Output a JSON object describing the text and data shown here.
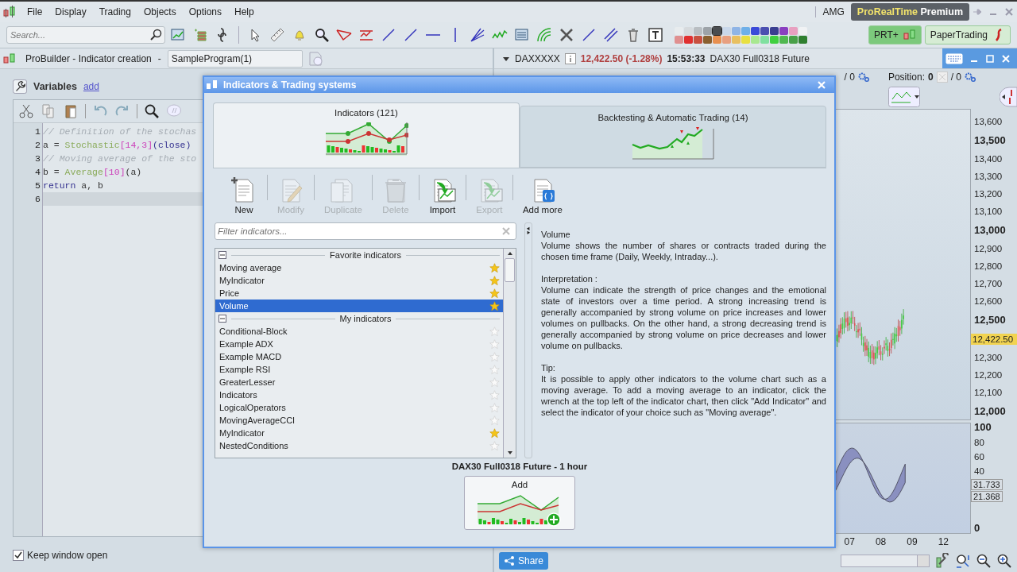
{
  "menu_bar": {
    "items": [
      "File",
      "Display",
      "Trading",
      "Objects",
      "Options",
      "Help"
    ],
    "user": "AMG",
    "edition": {
      "brand": "ProRealTime",
      "tier": "Premium"
    }
  },
  "toolbar": {
    "search_placeholder": "Search...",
    "swatches": [
      {
        "color": "#e8ecee",
        "selected": false
      },
      {
        "color": "#d6dadd",
        "selected": false
      },
      {
        "color": "#b9bec2",
        "selected": false
      },
      {
        "color": "#9da3a8",
        "selected": false
      },
      {
        "color": "#4a4d50",
        "selected": true
      },
      {
        "color": "#c9d8ea",
        "selected": false
      },
      {
        "color": "#8fb5e6",
        "selected": false
      },
      {
        "color": "#6fb0e8",
        "selected": false
      },
      {
        "color": "#3a4ad8",
        "selected": false
      },
      {
        "color": "#4a4fb0",
        "selected": false
      },
      {
        "color": "#3a3f90",
        "selected": false
      },
      {
        "color": "#8a3fc0",
        "selected": false
      },
      {
        "color": "#e8a0c0",
        "selected": false
      },
      {
        "color": "#f0f2f4",
        "selected": false
      },
      {
        "color": "#e09090",
        "selected": false
      },
      {
        "color": "#e03030",
        "selected": false
      },
      {
        "color": "#c85040",
        "selected": false
      },
      {
        "color": "#8a6030",
        "selected": false
      },
      {
        "color": "#e89050",
        "selected": false
      },
      {
        "color": "#e8a080",
        "selected": false
      },
      {
        "color": "#e8c060",
        "selected": false
      },
      {
        "color": "#e8e040",
        "selected": false
      },
      {
        "color": "#a8e890",
        "selected": false
      },
      {
        "color": "#80e0a0",
        "selected": false
      },
      {
        "color": "#40d040",
        "selected": false
      },
      {
        "color": "#50b850",
        "selected": false
      },
      {
        "color": "#48a048",
        "selected": false
      },
      {
        "color": "#308030",
        "selected": false
      }
    ],
    "buttons": [
      {
        "label": "PRT+",
        "kind": "prt"
      },
      {
        "label": "PaperTrading",
        "kind": "paper"
      }
    ]
  },
  "editor_window": {
    "title": "ProBuilder - Indicator creation",
    "separator": "-",
    "program": "SampleProgram(1)",
    "variables_label": "Variables",
    "add_link": "add",
    "code_lines": [
      {
        "number": "1",
        "current": false,
        "tokens": [
          {
            "kind": "comment",
            "text": "// Definition of the stochas"
          }
        ]
      },
      {
        "number": "2",
        "current": false,
        "tokens": [
          {
            "kind": "plain",
            "text": "a = "
          },
          {
            "kind": "function",
            "text": "Stochastic"
          },
          {
            "kind": "number",
            "text": "[14,3]"
          },
          {
            "kind": "keyword",
            "text": "(close)"
          }
        ]
      },
      {
        "number": "3",
        "current": false,
        "tokens": [
          {
            "kind": "comment",
            "text": "// Moving average of the sto"
          }
        ]
      },
      {
        "number": "4",
        "current": false,
        "tokens": [
          {
            "kind": "plain",
            "text": "b = "
          },
          {
            "kind": "function",
            "text": "Average"
          },
          {
            "kind": "number",
            "text": "[10]"
          },
          {
            "kind": "plain",
            "text": "(a)"
          }
        ]
      },
      {
        "number": "5",
        "current": false,
        "tokens": [
          {
            "kind": "keyword",
            "text": "return"
          },
          {
            "kind": "plain",
            "text": " a, b"
          }
        ]
      },
      {
        "number": "6",
        "current": true
      }
    ],
    "keep_open": {
      "label": "Keep window open",
      "checked": true
    }
  },
  "chart_window": {
    "symbol": "DAXXXXX",
    "price": "12,422.50 (-1.28%)",
    "time": "15:53:33",
    "instrument": "DAX30 Full0318 Future",
    "orders_fragment": "/ 0",
    "position_label": "Position:",
    "position_value": "0",
    "position_orders": "/ 0",
    "price_axis": [
      {
        "label": "13,600",
        "kind": "minor"
      },
      {
        "label": "13,500",
        "kind": "major"
      },
      {
        "label": "13,400",
        "kind": "minor"
      },
      {
        "label": "13,300",
        "kind": "minor"
      },
      {
        "label": "13,200",
        "kind": "minor"
      },
      {
        "label": "13,100",
        "kind": "minor"
      },
      {
        "label": "13,000",
        "kind": "major"
      },
      {
        "label": "12,900",
        "kind": "minor"
      },
      {
        "label": "12,800",
        "kind": "minor"
      },
      {
        "label": "12,700",
        "kind": "minor"
      },
      {
        "label": "12,600",
        "kind": "minor"
      },
      {
        "label": "12,500",
        "kind": "major"
      },
      {
        "label": "12,422.50",
        "kind": "last"
      },
      {
        "label": "12,300",
        "kind": "minor"
      },
      {
        "label": "12,200",
        "kind": "minor"
      },
      {
        "label": "12,100",
        "kind": "minor"
      },
      {
        "label": "12,000",
        "kind": "major"
      }
    ],
    "indicator_axis": [
      {
        "label": "100",
        "major": true
      },
      {
        "label": "80",
        "major": false
      },
      {
        "label": "60",
        "major": false
      },
      {
        "label": "40",
        "major": false
      },
      {
        "label": "0",
        "major": true
      }
    ],
    "indicator_values": [
      "31.733",
      "21.368"
    ],
    "time_axis": [
      "07",
      "08",
      "09",
      "12"
    ],
    "share_label": "Share"
  },
  "dialog": {
    "title": "Indicators & Trading systems",
    "tabs": [
      {
        "label": "Indicators (121)",
        "selected": true,
        "kind": "indicators"
      },
      {
        "label": "Backtesting & Automatic Trading (14)",
        "selected": false,
        "kind": "backtest"
      }
    ],
    "actions": [
      {
        "label": "New",
        "kind": "new",
        "disabled": false
      },
      {
        "label": "Modify",
        "kind": "modify",
        "disabled": true
      },
      {
        "label": "Duplicate",
        "kind": "duplicate",
        "disabled": true
      },
      {
        "label": "Delete",
        "kind": "delete",
        "disabled": true
      },
      {
        "label": "Import",
        "kind": "import",
        "disabled": false
      },
      {
        "label": "Export",
        "kind": "export",
        "disabled": true
      },
      {
        "label": "Add more",
        "kind": "more",
        "disabled": false
      }
    ],
    "filter_placeholder": "Filter indicators...",
    "groups": [
      {
        "title": "Favorite indicators",
        "expanded": true,
        "items": [
          {
            "name": "Moving average",
            "favorite": true,
            "selected": false
          },
          {
            "name": "MyIndicator",
            "favorite": true,
            "selected": false
          },
          {
            "name": "Price",
            "favorite": true,
            "selected": false
          },
          {
            "name": "Volume",
            "favorite": true,
            "selected": true
          }
        ]
      },
      {
        "title": "My indicators",
        "expanded": true,
        "items": [
          {
            "name": "Conditional-Block",
            "favorite": false,
            "selected": false
          },
          {
            "name": "Example ADX",
            "favorite": false,
            "selected": false
          },
          {
            "name": "Example MACD",
            "favorite": false,
            "selected": false
          },
          {
            "name": "Example RSI",
            "favorite": false,
            "selected": false
          },
          {
            "name": "GreaterLesser",
            "favorite": false,
            "selected": false
          },
          {
            "name": "Indicators",
            "favorite": false,
            "selected": false
          },
          {
            "name": "LogicalOperators",
            "favorite": false,
            "selected": false
          },
          {
            "name": "MovingAverageCCI",
            "favorite": false,
            "selected": false
          },
          {
            "name": "MyIndicator",
            "favorite": true,
            "selected": false
          },
          {
            "name": "NestedConditions",
            "favorite": false,
            "selected": false
          }
        ]
      }
    ],
    "description": {
      "title": "Volume",
      "paragraphs": [
        "Volume shows the number of shares or contracts traded during the chosen time frame (Daily, Weekly, Intraday...).",
        "Interpretation :\nVolume can indicate the strength of price changes and the emotional state of investors over a time period. A strong increasing trend is generally accompanied by strong volume on price increases and lower volumes on pullbacks. On the other hand, a strong decreasing trend is generally accompanied by strong volume on price decreases and lower volume on pullbacks.",
        "Tip:\nIt is possible to apply other indicators to the volume chart such as a moving average. To add a moving average to an indicator, click the wrench at the top left of the indicator chart, then click \"Add Indicator\" and select the indicator of your choice such as \"Moving average\"."
      ]
    },
    "target": "DAX30 Full0318 Future - 1 hour",
    "add_label": "Add"
  }
}
